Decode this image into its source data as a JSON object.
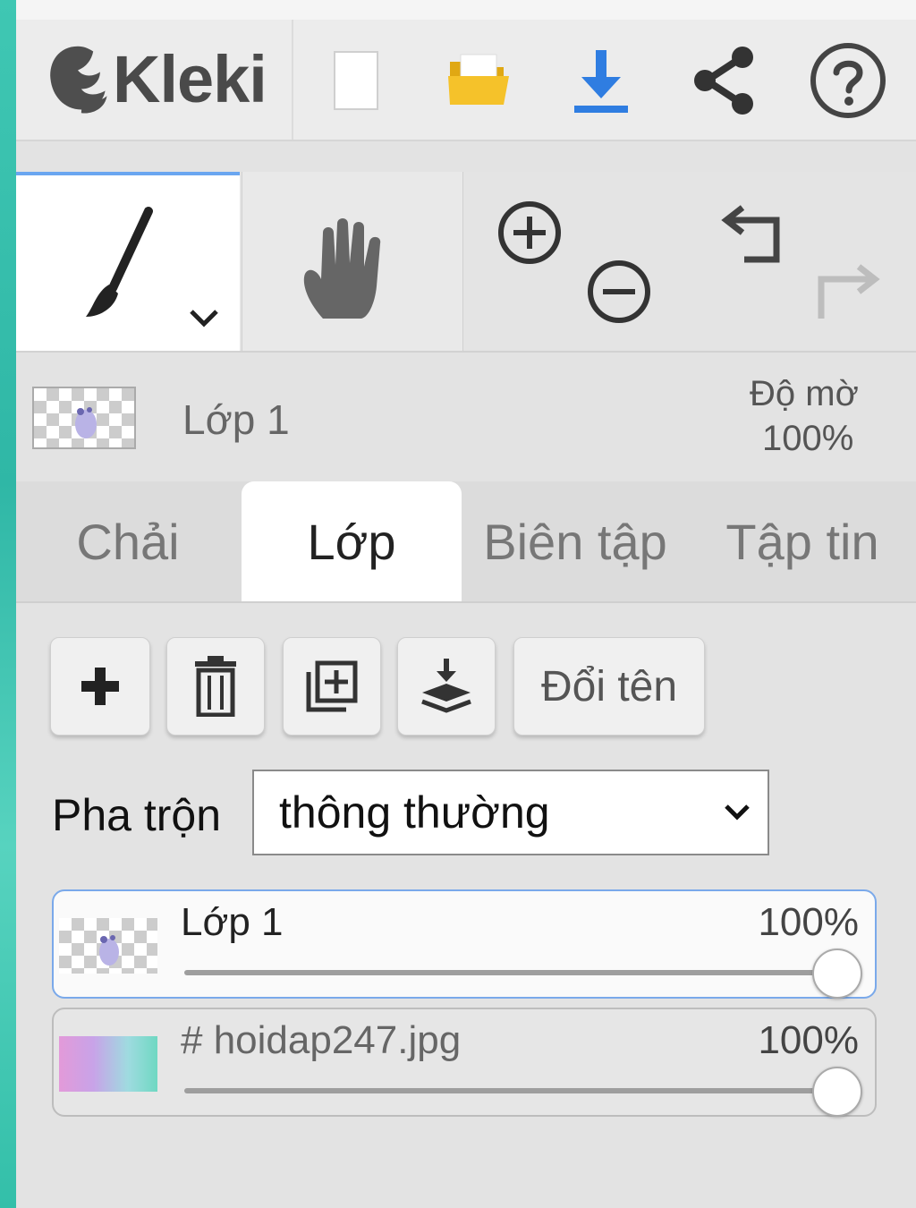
{
  "app": {
    "name": "Kleki"
  },
  "layer_info": {
    "name": "Lớp 1",
    "opacity_label": "Độ mờ",
    "opacity_value": "100%"
  },
  "tabs": [
    {
      "label": "Chải"
    },
    {
      "label": "Lớp"
    },
    {
      "label": "Biên tập"
    },
    {
      "label": "Tập tin"
    }
  ],
  "actions": {
    "rename_label": "Đổi tên"
  },
  "blend": {
    "label": "Pha trộn",
    "value": "thông thường"
  },
  "layers": [
    {
      "name": "Lớp 1",
      "opacity": "100%",
      "opacity_fraction": 1.0
    },
    {
      "name": "# hoidap247.jpg",
      "opacity": "100%",
      "opacity_fraction": 1.0
    }
  ],
  "colors": {
    "accent": "#2f7de1",
    "folder": "#f5c22a",
    "selected_border": "#7aa9ea"
  }
}
